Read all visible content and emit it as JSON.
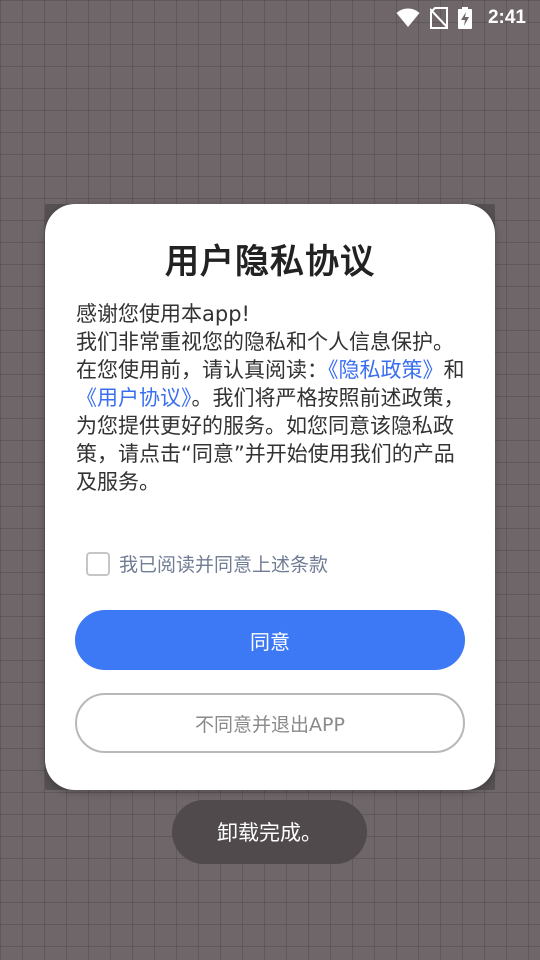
{
  "status_bar": {
    "time": "2:41",
    "icons": [
      "wifi-icon",
      "no-sim-icon",
      "battery-charging-icon"
    ]
  },
  "dialog": {
    "title": "用户隐私协议",
    "body": {
      "line_greeting": "感谢您使用本app!",
      "intro": "我们非常重视您的隐私和个人信息保护。在您使用前，请认真阅读：",
      "privacy_link": "《隐私政策》",
      "and": "和",
      "agreement_link": "《用户协议》",
      "outro": "。我们将严格按照前述政策，为您提供更好的服务。如您同意该隐私政策，请点击“同意”并开始使用我们的产品及服务。"
    },
    "consent_checkbox": {
      "label": "我已阅读并同意上述条款",
      "checked": false
    },
    "agree_button": "同意",
    "disagree_button": "不同意并退出APP"
  },
  "toast": {
    "text": "卸载完成。"
  },
  "colors": {
    "accent": "#3d78f5",
    "link": "#3a6ff0"
  }
}
